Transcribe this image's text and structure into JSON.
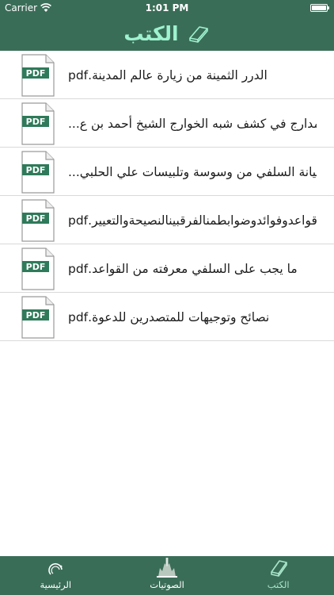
{
  "status_bar": {
    "carrier": "Carrier",
    "time": "1:01 PM"
  },
  "nav": {
    "title": "الكتب"
  },
  "icons": {
    "pdf_label": "PDF"
  },
  "books": [
    {
      "title": "الدرر الثمينة من زيارة عالم المدينة.pdf"
    },
    {
      "title": "المدارج في كشف شبه الخوارج الشيخ أحمد بن ع..."
    },
    {
      "title": "صيانة السلفي من وسوسة وتلبيسات علي الحلبي..."
    },
    {
      "title": "قواعدوفوائدوضوابطمنالفرقبينالنصيحةوالتعيير.pdf"
    },
    {
      "title": "ما يجب على السلفي معرفته من القواعد.pdf"
    },
    {
      "title": "نصائح وتوجيهات للمتصدرين للدعوة.pdf"
    }
  ],
  "tabs": [
    {
      "label": "الرئيسية"
    },
    {
      "label": "الصوتيات"
    },
    {
      "label": "الكتب"
    }
  ],
  "colors": {
    "bar": "#3a6d58",
    "title_accent": "#9ff2cf",
    "pdf_badge": "#2f7a5a"
  }
}
